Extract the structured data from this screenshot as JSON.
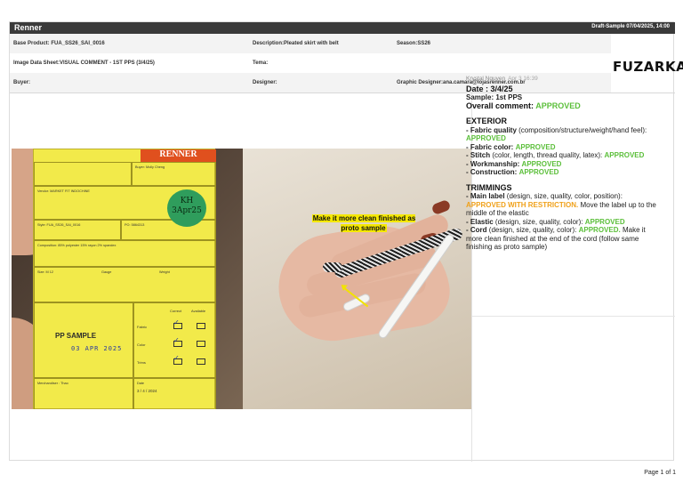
{
  "header": {
    "brand": "Renner",
    "draft_stamp": "Draft-Sample 07/04/2025, 14:00",
    "logo_text": "FUZARKA",
    "rows": [
      [
        "Base Product: FUA_SS26_SAI_0016",
        "Description:Pleated skirt with belt",
        "Season:SS26"
      ],
      [
        "Image Data Sheet:VISUAL COMMENT - 1ST PPS (3/4/25)",
        "Tema:",
        ""
      ],
      [
        "Buyer:",
        "Designer:",
        "Graphic Designer:ana.camara@lojasrenner.com.br"
      ]
    ]
  },
  "photo_left": {
    "brand_band": "RENNER",
    "fields": {
      "supplier": "Buyer: Molly Cheng",
      "vendor": "Vendor: MARKET FIT INDOCHINE",
      "style": "Style: FUA_SS26_SAI_0016",
      "po": "PO: 5864313",
      "composition": "Composition: 85% polyester 15% rayon 2% spandex",
      "size": "Size: M 12",
      "gauge": "Gauge",
      "weight": "Weight",
      "pp_sample": "PP SAMPLE",
      "date_stamp": "03 APR 2025",
      "merchandiser": "Merchandiser : Thao",
      "date_label": "Date",
      "date_value": "3   / 4   / 2024",
      "correct": "Correct",
      "available": "Available",
      "row_fabric": "Fabric",
      "row_color": "Color",
      "row_trims": "Trims",
      "stamp_text": "KH 3Apr25"
    }
  },
  "photo_right": {
    "annotation": "Make it more clean finished as proto sample"
  },
  "comment": {
    "author": "Krystal Nguyen",
    "time": "Apr 3 16:39",
    "date_line": "Date : 3/4/25",
    "sample_line": "Sample: 1st PPS",
    "overall_label": "Overall comment:",
    "overall_value": "APPROVED",
    "exterior_title": "EXTERIOR",
    "ext_fabric_quality_label": "- Fabric quality",
    "ext_fabric_quality_desc": "(composition/structure/weight/hand feel):",
    "ext_fabric_quality_value": "APPROVED",
    "ext_fabric_color_label": "- Fabric color:",
    "ext_fabric_color_value": "APPROVED",
    "ext_stitch_label": "- Stitch",
    "ext_stitch_desc": "(color, length, thread quality, latex):",
    "ext_stitch_value": "APPROVED",
    "ext_workmanship_label": "- Workmanship:",
    "ext_workmanship_value": "APPROVED",
    "ext_construction_label": "- Construction:",
    "ext_construction_value": "APPROVED",
    "trimmings_title": "TRIMMINGS",
    "trim_main_label": "- Main label",
    "trim_main_desc": "(design, size, quality, color, position):",
    "trim_main_value": "APPROVED WITH RESTRICTION.",
    "trim_main_note": "Move the label up to the middle of the elastic",
    "trim_elastic_label": "- Elastic",
    "trim_elastic_desc": "(design, size, quality, color):",
    "trim_elastic_value": "APPROVED",
    "trim_cord_label": "- Cord",
    "trim_cord_desc": "(design, size, quality, color):",
    "trim_cord_value": "APPROVED.",
    "trim_cord_note": "Make it more clean finished at the end of the cord (follow same finishing as proto sample)"
  },
  "footer": {
    "page": "Page 1 of 1"
  },
  "colors": {
    "approved": "#5bbf3a",
    "restriction": "#f0a11a",
    "topbar": "#3a3a3a",
    "highlight": "#f5e800"
  }
}
